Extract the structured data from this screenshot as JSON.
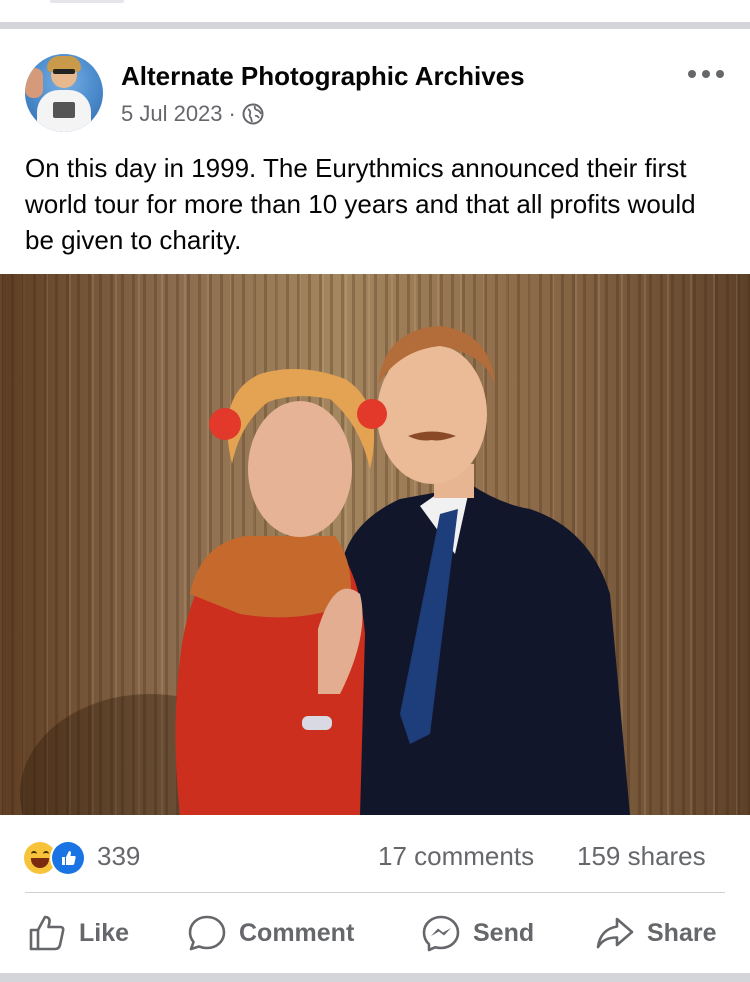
{
  "post": {
    "page_name": "Alternate Photographic Archives",
    "date": "5 Jul 2023",
    "separator": "·",
    "text": "On this day in 1999. The Eurythmics announced their first world tour for more than 10 years and that all profits would be given to charity."
  },
  "icons": {
    "avatar": "page-avatar",
    "audience": "globe-icon",
    "menu": "more-options-icon",
    "reactions": [
      "haha-icon",
      "like-icon"
    ]
  },
  "stats": {
    "reactions": "339",
    "comments": "17 comments",
    "shares": "159 shares"
  },
  "actions": {
    "like": "Like",
    "comment": "Comment",
    "send": "Send",
    "share": "Share"
  },
  "colors": {
    "text": "#050505",
    "secondary": "#65676b",
    "like_blue": "#1b74e4",
    "haha_yellow": "#f7c33b",
    "divider": "#d3d5da"
  }
}
